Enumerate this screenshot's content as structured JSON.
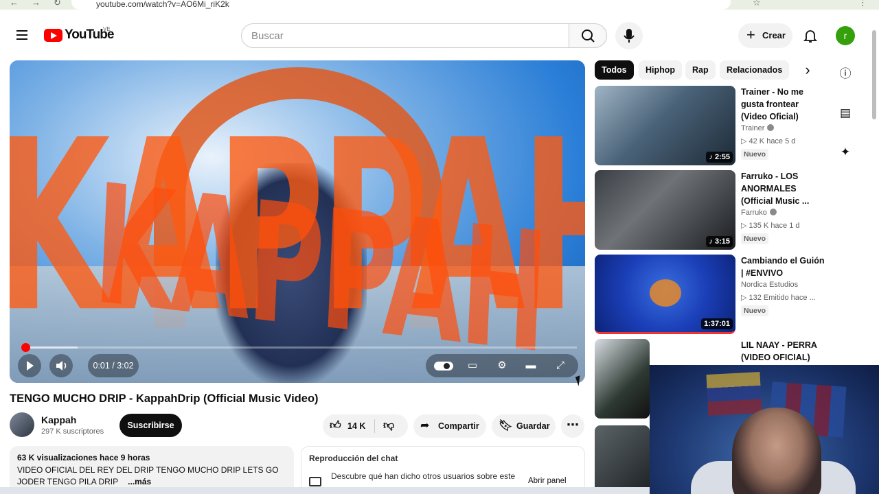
{
  "browser": {
    "url": "youtube.com/watch?v=AO6Mi_riK2k"
  },
  "masthead": {
    "logo_text": "YouTube",
    "country": "VE",
    "search_placeholder": "Buscar",
    "create_label": "Crear",
    "avatar_letter": "r"
  },
  "player": {
    "overlay_text": "KAPPAH",
    "time": "0:01 / 3:02",
    "progress_fraction": 0.006,
    "buffered_fraction": 0.1
  },
  "video": {
    "title": "TENGO MUCHO DRIP - KappahDrip (Official Music Video)",
    "channel": "Kappah",
    "subscribers": "297 K suscriptores",
    "subscribe_label": "Suscribirse",
    "likes": "14 K",
    "share_label": "Compartir",
    "save_label": "Guardar"
  },
  "description": {
    "meta": "63 K visualizaciones  hace 9 horas",
    "text": "VIDEO OFICIAL DEL REY DEL DRIP TENGO MUCHO DRIP LETS GO JODER TENGO PILA DRIP",
    "more": "...más"
  },
  "chat": {
    "title": "Reproducción del chat",
    "line": "Descubre qué han dicho otros usuarios sobre este",
    "open_label": "Abrir panel"
  },
  "chips": [
    "Todos",
    "Hiphop",
    "Rap",
    "Relacionados"
  ],
  "related": [
    {
      "title": "Trainer - No me gusta frontear (Video Oficial)",
      "channel": "Trainer",
      "stats": "42 K  hace 5 d",
      "badge": "Nuevo",
      "duration": "2:55",
      "verified": true,
      "music": true
    },
    {
      "title": "Farruko - LOS ANORMALES (Official Music ...",
      "channel": "Farruko",
      "stats": "135 K  hace 1 d",
      "badge": "Nuevo",
      "duration": "3:15",
      "verified": true,
      "music": true
    },
    {
      "title": "Cambiando el Guión | #ENVIVO",
      "channel": "Nordica Estudios",
      "stats": "132  Emitido hace ...",
      "badge": "Nuevo",
      "duration": "1:37:01",
      "verified": false,
      "music": false
    },
    {
      "title": "LIL NAAY - PERRA (VIDEO OFICIAL)",
      "channel": "",
      "stats": "",
      "badge": "",
      "duration": "",
      "verified": false,
      "music": false
    }
  ],
  "colors": {
    "brand": "#ff0000",
    "accent": "#0f0f0f",
    "avatar": "#34a00c"
  }
}
